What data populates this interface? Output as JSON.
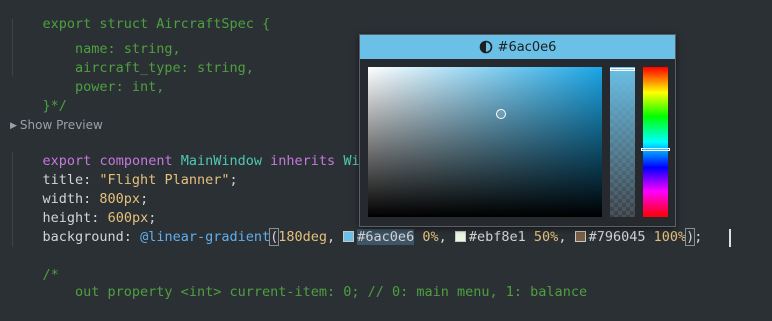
{
  "editor": {
    "lines": {
      "l0": "export struct AircraftSpec {",
      "l1": "    name: string,",
      "l2": "    aircraft_type: string,",
      "l3": "    power: int,",
      "l4": "}*/",
      "l6_kw1": "export",
      "l6_kw2": "component",
      "l6_name": "MainWindow",
      "l6_kw3": "inherits",
      "l6_base": "Window {",
      "title_prop": "title",
      "title_val": "\"Flight Planner\"",
      "width_prop": "width",
      "width_val": "800px",
      "height_prop": "height",
      "height_val": "600px",
      "bg_prop": "background",
      "bg_fn": "@linear-gradient",
      "bg_angle": "180deg",
      "stop1_color": "#6ac0e6",
      "stop1_pos": "0%",
      "stop2_color": "#ebf8e1",
      "stop2_pos": "50%",
      "stop3_color": "#796045",
      "stop3_pos": "100%",
      "comment_open": "/*",
      "last_line": "    out property <int> current-item: 0; // 0: main menu, 1: balance"
    },
    "show_preview": "Show Preview"
  },
  "color_picker": {
    "hex": "#6ac0e6",
    "icon": "contrast-icon",
    "colors": {
      "selected": "#6ac0e6",
      "stop2": "#ebf8e1",
      "stop3": "#796045"
    },
    "hue_level": 0.56,
    "alpha_level": 1.0,
    "saturation": 0.54,
    "value": 0.9
  }
}
